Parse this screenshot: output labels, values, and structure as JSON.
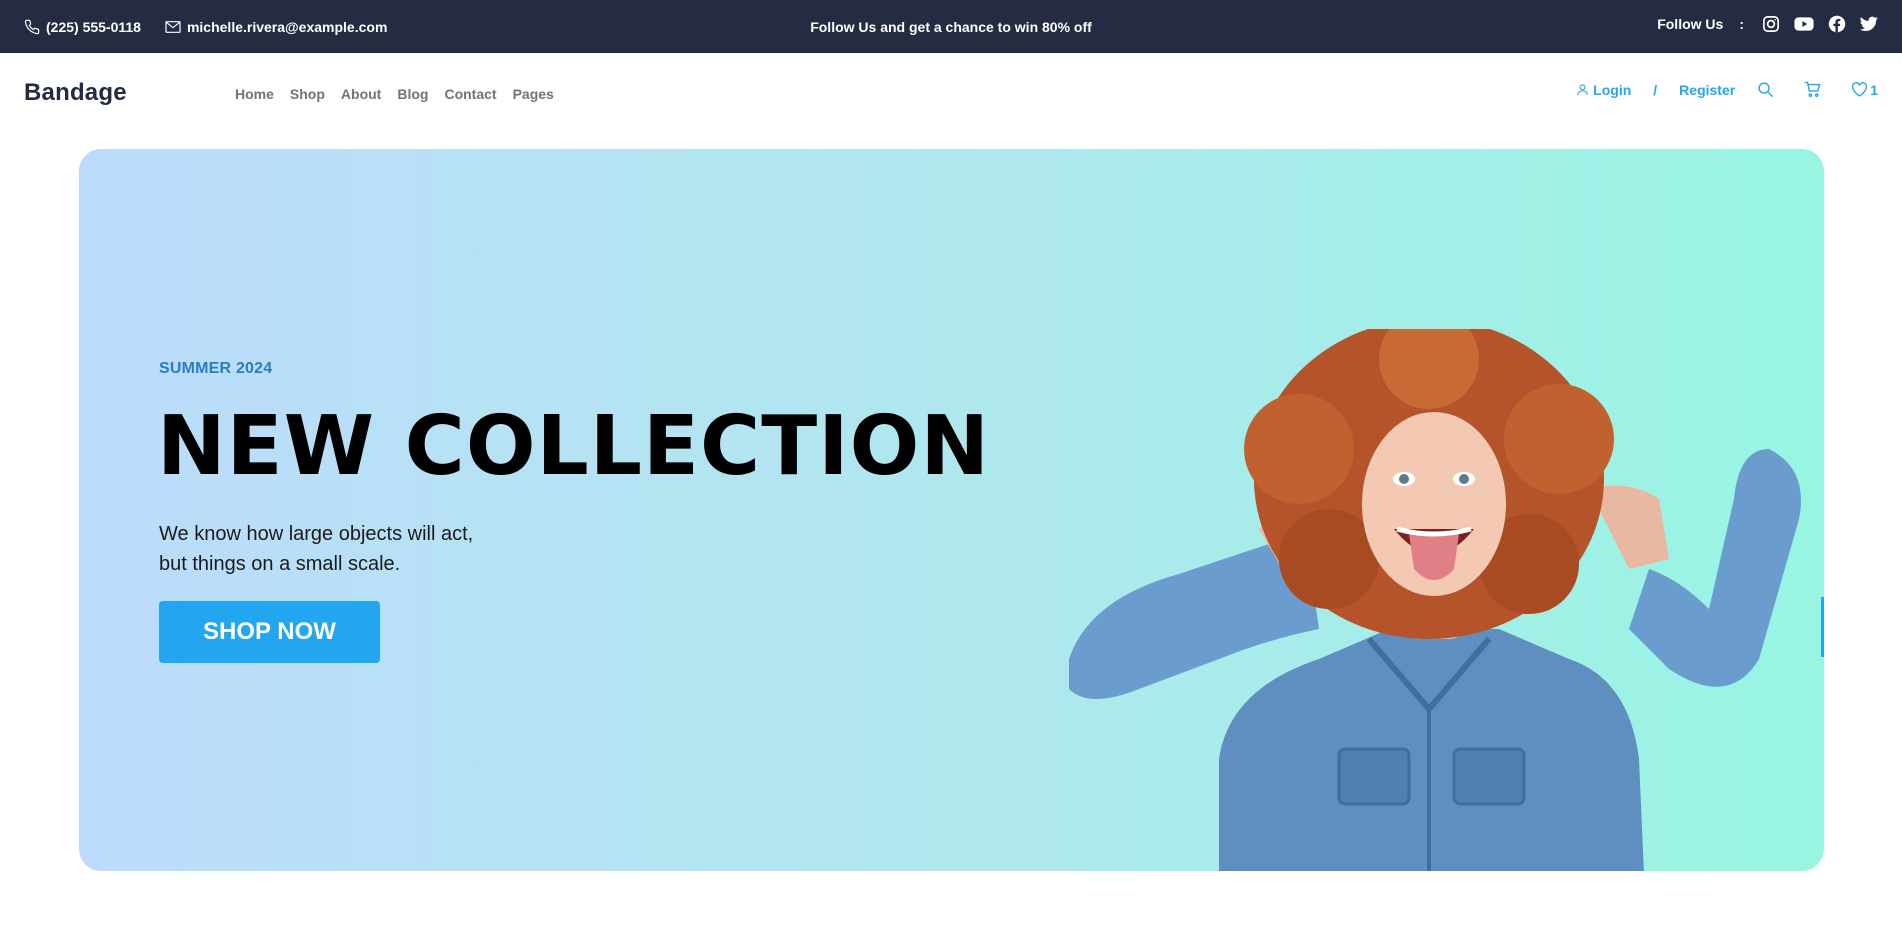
{
  "topbar": {
    "phone": "(225) 555-0118",
    "email": "michelle.rivera@example.com",
    "promo": "Follow Us and get a chance to win 80% off",
    "follow_label": "Follow Us",
    "follow_sep": ":",
    "social_icons": [
      "instagram-icon",
      "youtube-icon",
      "facebook-icon",
      "twitter-icon"
    ]
  },
  "nav": {
    "brand": "Bandage",
    "menu": [
      "Home",
      "Shop",
      "About",
      "Blog",
      "Contact",
      "Pages"
    ],
    "login": "Login",
    "separator": "/",
    "register": "Register",
    "wishlist_count": "1"
  },
  "hero": {
    "season": "SUMMER 2024",
    "headline": "NEW COLLECTION",
    "desc_line1": "We know how large objects will act,",
    "desc_line2": "but things on a small scale.",
    "cta": "SHOP NOW"
  },
  "colors": {
    "topbar_bg": "#252b42",
    "accent": "#23a6f0",
    "menu_text": "#737373",
    "season_text": "#2a7cc7"
  }
}
